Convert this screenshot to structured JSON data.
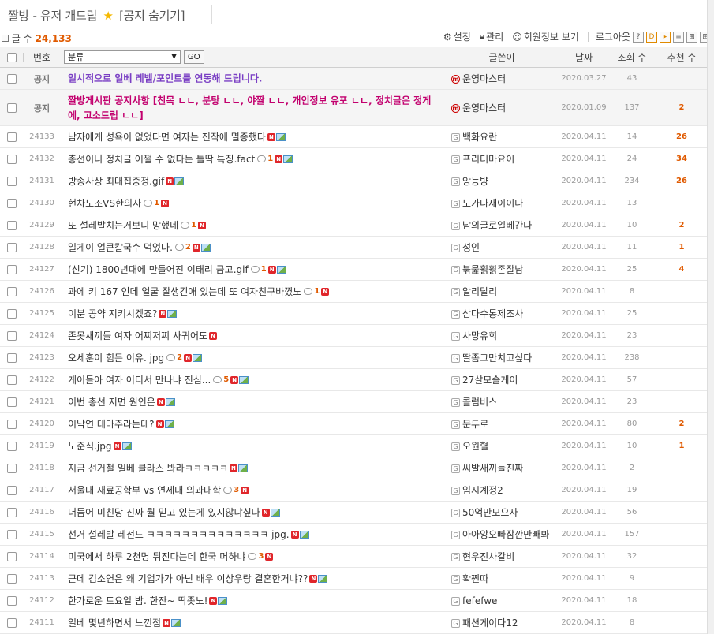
{
  "board": {
    "title": "짤방 - 유저 개드립",
    "notice_toggle": "[공지 숨기기]"
  },
  "info": {
    "count_label": "글 수",
    "count_value": "24,133",
    "settings": "설정",
    "manage": "관리",
    "member_info": "회원정보 보기",
    "logout": "로그아웃"
  },
  "header": {
    "number": "번호",
    "category": "분류",
    "go": "GO",
    "author": "글쓴이",
    "date": "날짜",
    "views": "조회 수",
    "recommend": "추천 수"
  },
  "notices": [
    {
      "label": "공지",
      "title": "일시적으로 일베 레벨/포인트를 연동해 드립니다.",
      "author": "운영마스터",
      "date": "2020.03.27",
      "views": "43",
      "rec": ""
    },
    {
      "label": "공지",
      "title": "짤방게시판 공지사항 [친목 ㄴㄴ, 분탕 ㄴㄴ, 야짤 ㄴㄴ, 개인정보 유포 ㄴㄴ, 정치글은 정게에, 고소드립 ㄴㄴ]",
      "author": "운영마스터",
      "date": "2020.01.09",
      "views": "137",
      "rec": "2"
    }
  ],
  "posts": [
    {
      "no": "24133",
      "title": "남자에게 성욕이 없었다면 여자는 진작에 멸종했다",
      "comments": "",
      "new": true,
      "img": true,
      "author": "백화요란",
      "date": "2020.04.11",
      "views": "14",
      "rec": "26"
    },
    {
      "no": "24132",
      "title": "총선이니 정치글 어쩔 수 없다는 틀딱 특징.fact",
      "comments": "1",
      "new": true,
      "img": true,
      "author": "프리더마요이",
      "date": "2020.04.11",
      "views": "24",
      "rec": "34"
    },
    {
      "no": "24131",
      "title": "방송사상 최대집중정.gif",
      "comments": "",
      "new": true,
      "img": true,
      "author": "앙능뱡",
      "date": "2020.04.11",
      "views": "234",
      "rec": "26"
    },
    {
      "no": "24130",
      "title": "현차노조VS한의사",
      "comments": "1",
      "new": true,
      "img": false,
      "author": "노가다재이이다",
      "date": "2020.04.11",
      "views": "13",
      "rec": ""
    },
    {
      "no": "24129",
      "title": "또 설레발치는거보니 망했네",
      "comments": "1",
      "new": true,
      "img": false,
      "author": "남의글로일베간다",
      "date": "2020.04.11",
      "views": "10",
      "rec": "2"
    },
    {
      "no": "24128",
      "title": "일게이 얼큰칼국수 먹었다.",
      "comments": "2",
      "new": true,
      "img": true,
      "author": "성인",
      "date": "2020.04.11",
      "views": "11",
      "rec": "1"
    },
    {
      "no": "24127",
      "title": "(신기) 1800년대에 만들어진 이태리 금고.gif",
      "comments": "1",
      "new": true,
      "img": true,
      "author": "붂뭁훩훩존잘남",
      "date": "2020.04.11",
      "views": "25",
      "rec": "4"
    },
    {
      "no": "24126",
      "title": "과에 키 167 인데 얼굴 잘생긴애 있는데 또 여자친구바꼈노",
      "comments": "1",
      "new": true,
      "img": false,
      "author": "알리달리",
      "date": "2020.04.11",
      "views": "8",
      "rec": ""
    },
    {
      "no": "24125",
      "title": "이분 공약 지키시겠죠?",
      "comments": "",
      "new": true,
      "img": true,
      "author": "삼다수통제조사",
      "date": "2020.04.11",
      "views": "25",
      "rec": ""
    },
    {
      "no": "24124",
      "title": "존못새끼들 여자 어찌저찌 사귀어도",
      "comments": "",
      "new": true,
      "img": false,
      "author": "사망유희",
      "date": "2020.04.11",
      "views": "23",
      "rec": ""
    },
    {
      "no": "24123",
      "title": "오세훈이 힘든 이유. jpg",
      "comments": "2",
      "new": true,
      "img": true,
      "author": "딸좀그만치고싶다",
      "date": "2020.04.11",
      "views": "238",
      "rec": ""
    },
    {
      "no": "24122",
      "title": "게이들아 여자 어디서 만나냐 진심...",
      "comments": "5",
      "new": true,
      "img": true,
      "author": "27살모솔게이",
      "date": "2020.04.11",
      "views": "57",
      "rec": ""
    },
    {
      "no": "24121",
      "title": "이번 총선 지면 원인은",
      "comments": "",
      "new": true,
      "img": true,
      "author": "콜럼버스",
      "date": "2020.04.11",
      "views": "23",
      "rec": ""
    },
    {
      "no": "24120",
      "title": "이낙연 테마주라는데?",
      "comments": "",
      "new": true,
      "img": true,
      "author": "문두로",
      "date": "2020.04.11",
      "views": "80",
      "rec": "2"
    },
    {
      "no": "24119",
      "title": "노준식.jpg",
      "comments": "",
      "new": true,
      "img": true,
      "author": "오원혈",
      "date": "2020.04.11",
      "views": "10",
      "rec": "1"
    },
    {
      "no": "24118",
      "title": "지금 선거철 일베 클라스 봐라ㅋㅋㅋㅋㅋ",
      "comments": "",
      "new": true,
      "img": true,
      "author": "씨발새끼들진짜",
      "date": "2020.04.11",
      "views": "2",
      "rec": ""
    },
    {
      "no": "24117",
      "title": "서울대 재료공학부 vs 연세대 의과대학",
      "comments": "3",
      "new": true,
      "img": false,
      "author": "임시계정2",
      "date": "2020.04.11",
      "views": "19",
      "rec": ""
    },
    {
      "no": "24116",
      "title": "더듬어 미친당 진짜 뭘 믿고 있는게 있지않냐싶다",
      "comments": "",
      "new": true,
      "img": true,
      "author": "50억만모으자",
      "date": "2020.04.11",
      "views": "56",
      "rec": ""
    },
    {
      "no": "24115",
      "title": "선거 설레발 레전드 ㅋㅋㅋㅋㅋㅋㅋㅋㅋㅋㅋㅋㅋㅋ jpg.",
      "comments": "",
      "new": true,
      "img": true,
      "author": "아아앙오빠잠깐만빼봐",
      "date": "2020.04.11",
      "views": "157",
      "rec": ""
    },
    {
      "no": "24114",
      "title": "미국에서 하루 2천명 뒤진다는데 한국 머하냐",
      "comments": "3",
      "new": true,
      "img": false,
      "author": "현우진사갈비",
      "date": "2020.04.11",
      "views": "32",
      "rec": ""
    },
    {
      "no": "24113",
      "title": "근데 김소연은 왜 기업가가 아닌 배우 이상우랑 결혼한거냐??",
      "comments": "",
      "new": true,
      "img": true,
      "author": "확찐따",
      "date": "2020.04.11",
      "views": "9",
      "rec": ""
    },
    {
      "no": "24112",
      "title": "한가로운 토요일 밤. 한잔~ 딱좃노!",
      "comments": "",
      "new": true,
      "img": true,
      "author": "fefefwe",
      "date": "2020.04.11",
      "views": "18",
      "rec": ""
    },
    {
      "no": "24111",
      "title": "일베 몇년하면서 느낀점",
      "comments": "",
      "new": true,
      "img": true,
      "author": "패션게이다12",
      "date": "2020.04.11",
      "views": "8",
      "rec": ""
    }
  ]
}
